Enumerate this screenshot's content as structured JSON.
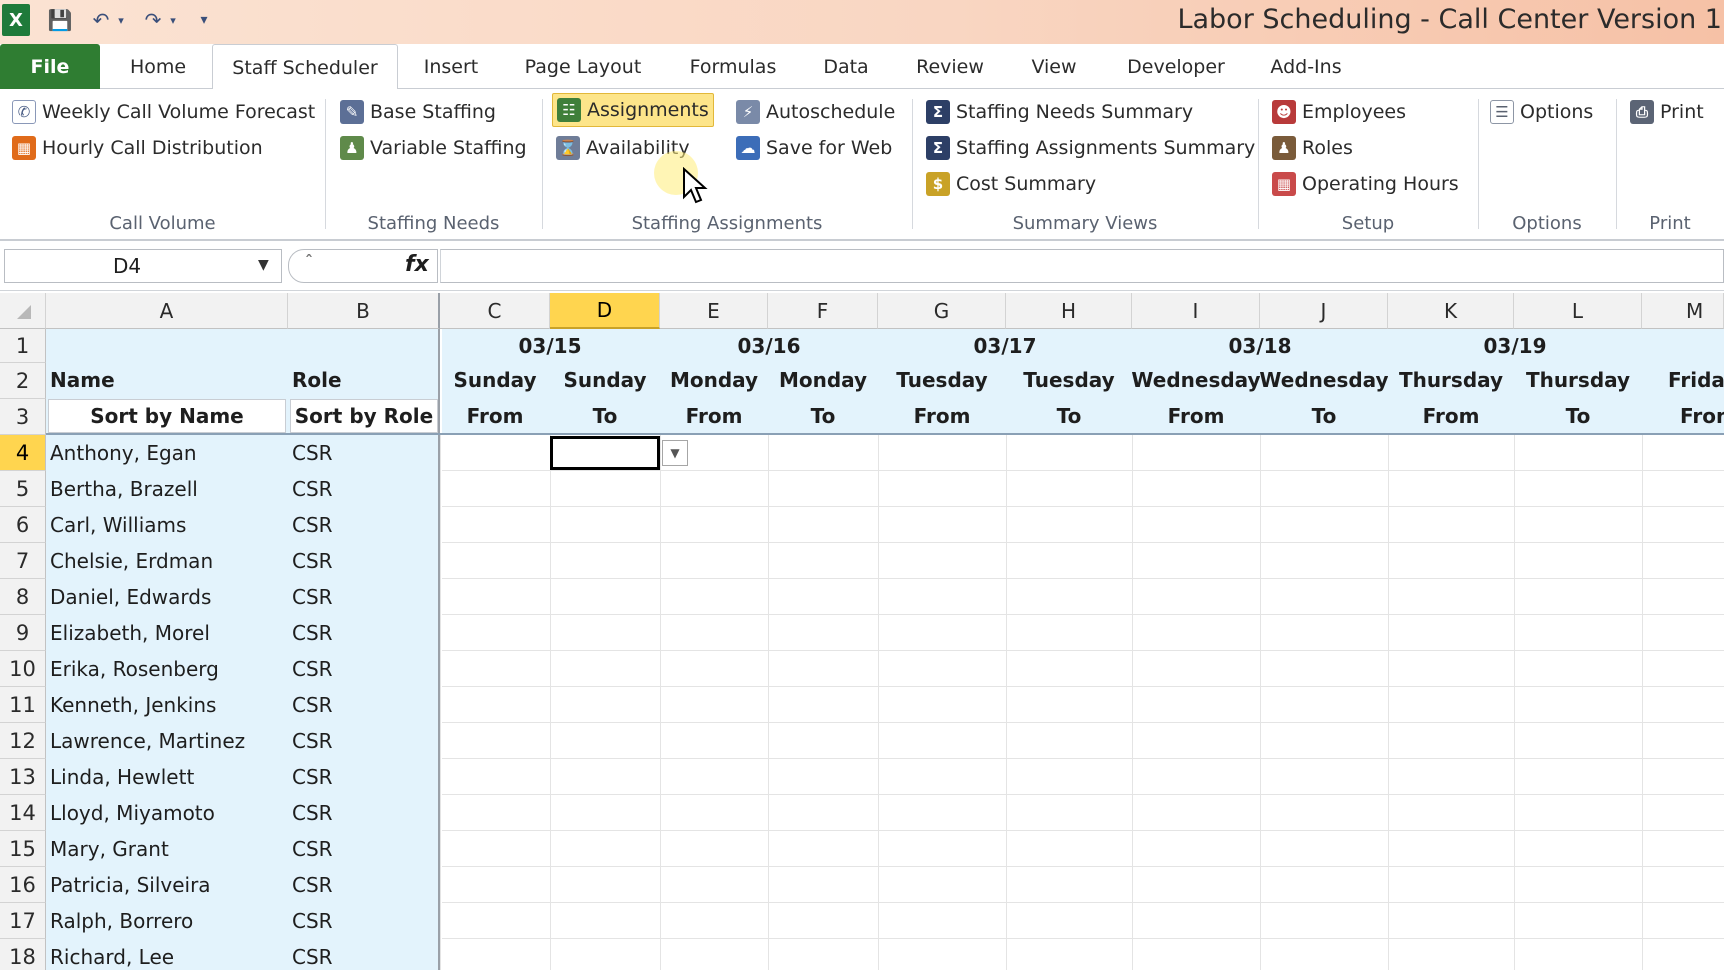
{
  "window": {
    "title": "Labor Scheduling - Call Center Version 1"
  },
  "tabs": [
    "File",
    "Home",
    "Staff Scheduler",
    "Insert",
    "Page Layout",
    "Formulas",
    "Data",
    "Review",
    "View",
    "Developer",
    "Add-Ins"
  ],
  "ribbon": {
    "call_volume": {
      "label": "Call Volume",
      "weekly": "Weekly Call Volume Forecast",
      "hourly": "Hourly Call Distribution"
    },
    "staffing_needs": {
      "label": "Staffing Needs",
      "base": "Base Staffing",
      "variable": "Variable Staffing"
    },
    "staffing_assignments": {
      "label": "Staffing Assignments",
      "assignments": "Assignments",
      "autoschedule": "Autoschedule",
      "availability": "Availability",
      "save_web": "Save for Web"
    },
    "summary_views": {
      "label": "Summary Views",
      "needs": "Staffing Needs Summary",
      "assign": "Staffing Assignments Summary",
      "cost": "Cost Summary"
    },
    "setup": {
      "label": "Setup",
      "employees": "Employees",
      "roles": "Roles",
      "hours": "Operating Hours"
    },
    "options": {
      "label": "Options",
      "btn": "Options"
    },
    "print": {
      "label": "Print",
      "btn": "Print"
    }
  },
  "formula_bar": {
    "name_box": "D4",
    "fx": "fx",
    "value": ""
  },
  "sheet": {
    "columns": [
      "A",
      "B",
      "C",
      "D",
      "E",
      "F",
      "G",
      "H",
      "I",
      "J",
      "K",
      "L",
      "M"
    ],
    "row1_dates": [
      "03/15",
      "03/16",
      "03/17",
      "03/18",
      "03/19"
    ],
    "row2": {
      "name": "Name",
      "role": "Role",
      "days": [
        "Sunday",
        "Sunday",
        "Monday",
        "Monday",
        "Tuesday",
        "Tuesday",
        "Wednesday",
        "Wednesday",
        "Thursday",
        "Thursday",
        "Friday"
      ]
    },
    "row3": {
      "sort_name": "Sort by Name",
      "sort_role": "Sort by Role",
      "labels": [
        "From",
        "To",
        "From",
        "To",
        "From",
        "To",
        "From",
        "To",
        "From",
        "To",
        "From"
      ]
    },
    "rows": [
      {
        "n": "4",
        "name": "Anthony, Egan",
        "role": "CSR"
      },
      {
        "n": "5",
        "name": "Bertha, Brazell",
        "role": "CSR"
      },
      {
        "n": "6",
        "name": "Carl, Williams",
        "role": "CSR"
      },
      {
        "n": "7",
        "name": "Chelsie, Erdman",
        "role": "CSR"
      },
      {
        "n": "8",
        "name": "Daniel, Edwards",
        "role": "CSR"
      },
      {
        "n": "9",
        "name": "Elizabeth, Morel",
        "role": "CSR"
      },
      {
        "n": "10",
        "name": "Erika, Rosenberg",
        "role": "CSR"
      },
      {
        "n": "11",
        "name": "Kenneth, Jenkins",
        "role": "CSR"
      },
      {
        "n": "12",
        "name": "Lawrence, Martinez",
        "role": "CSR"
      },
      {
        "n": "13",
        "name": "Linda, Hewlett",
        "role": "CSR"
      },
      {
        "n": "14",
        "name": "Lloyd, Miyamoto",
        "role": "CSR"
      },
      {
        "n": "15",
        "name": "Mary, Grant",
        "role": "CSR"
      },
      {
        "n": "16",
        "name": "Patricia, Silveira",
        "role": "CSR"
      },
      {
        "n": "17",
        "name": "Ralph, Borrero",
        "role": "CSR"
      },
      {
        "n": "18",
        "name": "Richard, Lee",
        "role": "CSR"
      }
    ]
  },
  "colors": {
    "header_fill": "#e3f3fc",
    "selected_header": "#ffd54f",
    "file_tab": "#2f7d32",
    "highlight": "#fde58a"
  }
}
